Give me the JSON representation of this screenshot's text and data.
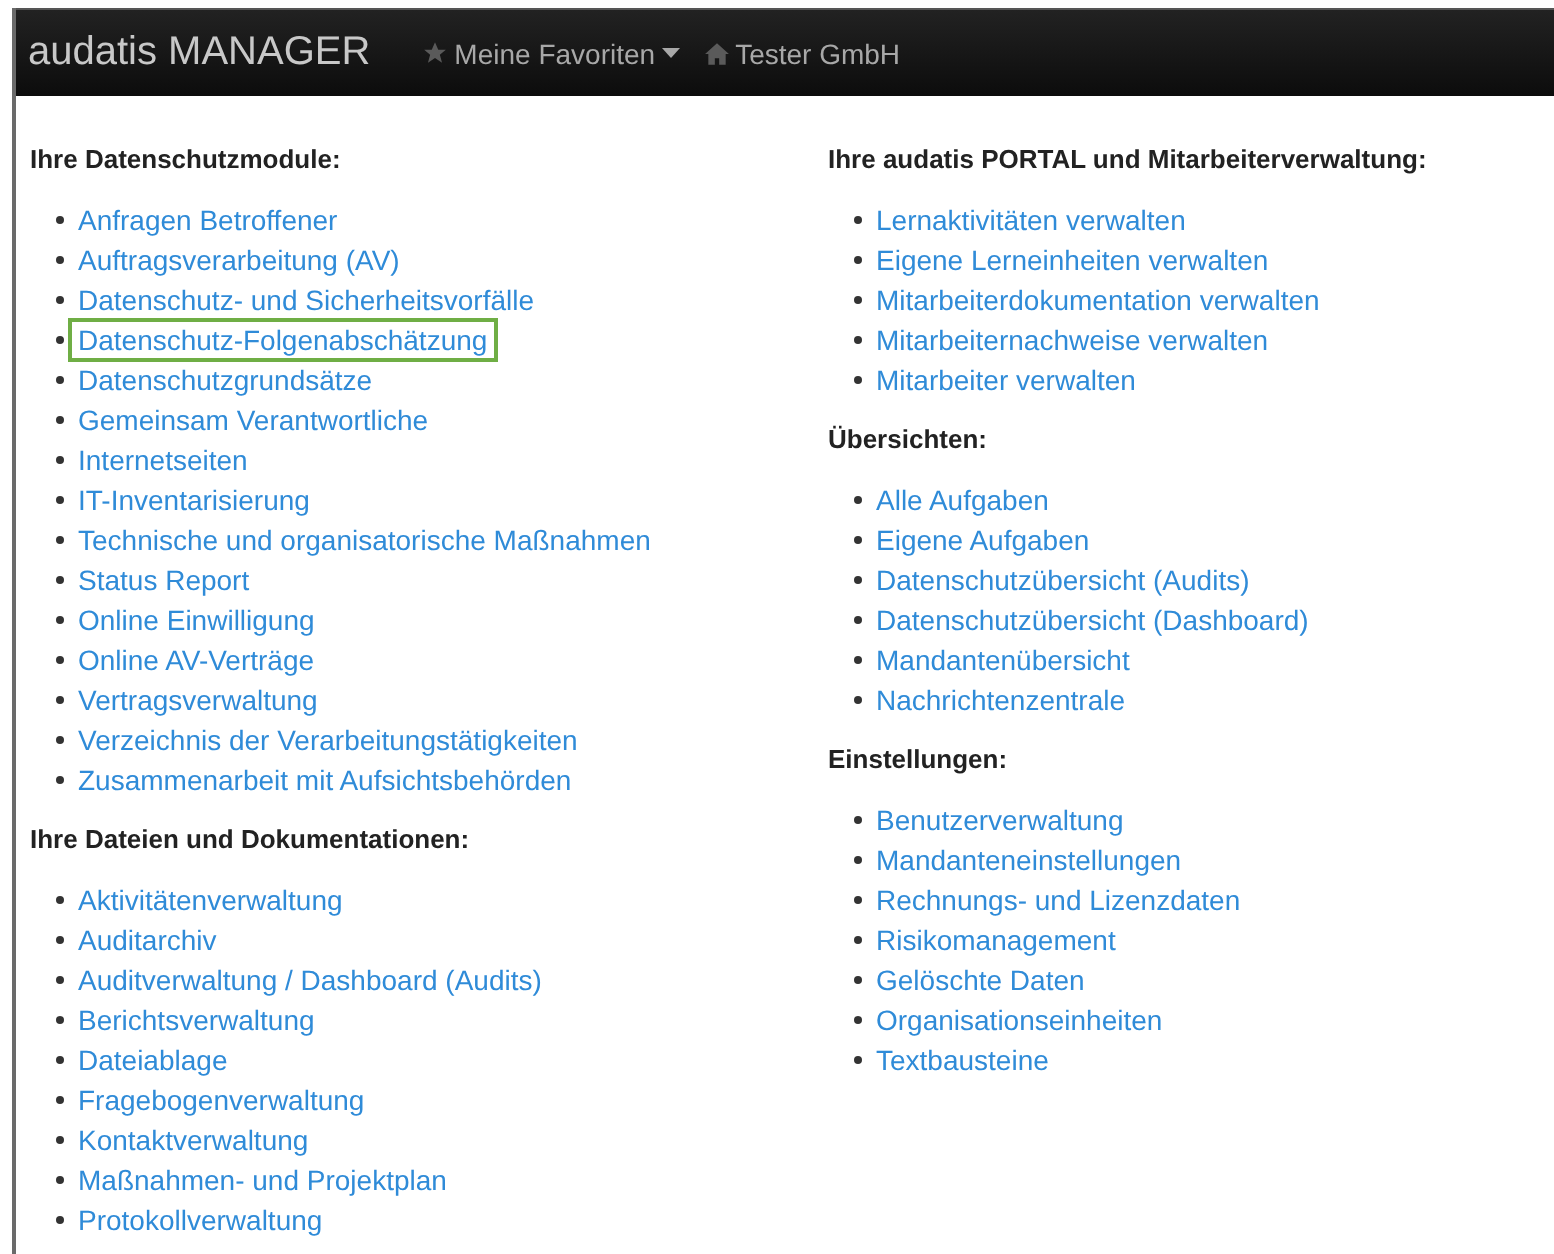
{
  "navbar": {
    "brand": "audatis MANAGER",
    "menus": [
      {
        "kind": "dropdown",
        "label": "Meine Favoriten"
      },
      {
        "kind": "home",
        "label": "Tester GmbH"
      }
    ]
  },
  "columns": [
    {
      "sections": [
        {
          "heading": "Ihre Datenschutzmodule:",
          "links": [
            {
              "label": "Anfragen Betroffener",
              "highlighted": false
            },
            {
              "label": "Auftragsverarbeitung (AV)",
              "highlighted": false
            },
            {
              "label": "Datenschutz- und Sicherheitsvorfälle",
              "highlighted": false
            },
            {
              "label": "Datenschutz-Folgenabschätzung",
              "highlighted": true
            },
            {
              "label": "Datenschutzgrundsätze",
              "highlighted": false
            },
            {
              "label": "Gemeinsam Verantwortliche",
              "highlighted": false
            },
            {
              "label": "Internetseiten",
              "highlighted": false
            },
            {
              "label": "IT-Inventarisierung",
              "highlighted": false
            },
            {
              "label": "Technische und organisatorische Maßnahmen",
              "highlighted": false
            },
            {
              "label": "Status Report",
              "highlighted": false
            },
            {
              "label": "Online Einwilligung",
              "highlighted": false
            },
            {
              "label": "Online AV-Verträge",
              "highlighted": false
            },
            {
              "label": "Vertragsverwaltung",
              "highlighted": false
            },
            {
              "label": "Verzeichnis der Verarbeitungstätigkeiten",
              "highlighted": false
            },
            {
              "label": "Zusammenarbeit mit Aufsichtsbehörden",
              "highlighted": false
            }
          ]
        },
        {
          "heading": "Ihre Dateien und Dokumentationen:",
          "links": [
            {
              "label": "Aktivitätenverwaltung",
              "highlighted": false
            },
            {
              "label": "Auditarchiv",
              "highlighted": false
            },
            {
              "label": "Auditverwaltung / Dashboard (Audits)",
              "highlighted": false
            },
            {
              "label": "Berichtsverwaltung",
              "highlighted": false
            },
            {
              "label": "Dateiablage",
              "highlighted": false
            },
            {
              "label": "Fragebogenverwaltung",
              "highlighted": false
            },
            {
              "label": "Kontaktverwaltung",
              "highlighted": false
            },
            {
              "label": "Maßnahmen- und Projektplan",
              "highlighted": false
            },
            {
              "label": "Protokollverwaltung",
              "highlighted": false
            }
          ]
        }
      ]
    },
    {
      "sections": [
        {
          "heading": "Ihre audatis PORTAL und Mitarbeiterverwaltung:",
          "links": [
            {
              "label": "Lernaktivitäten verwalten",
              "highlighted": false
            },
            {
              "label": "Eigene Lerneinheiten verwalten",
              "highlighted": false
            },
            {
              "label": "Mitarbeiterdokumentation verwalten",
              "highlighted": false
            },
            {
              "label": "Mitarbeiternachweise verwalten",
              "highlighted": false
            },
            {
              "label": "Mitarbeiter verwalten",
              "highlighted": false
            }
          ]
        },
        {
          "heading": "Übersichten:",
          "links": [
            {
              "label": "Alle Aufgaben",
              "highlighted": false
            },
            {
              "label": "Eigene Aufgaben",
              "highlighted": false
            },
            {
              "label": "Datenschutzübersicht (Audits)",
              "highlighted": false
            },
            {
              "label": "Datenschutzübersicht (Dashboard)",
              "highlighted": false
            },
            {
              "label": "Mandantenübersicht",
              "highlighted": false
            },
            {
              "label": "Nachrichtenzentrale",
              "highlighted": false
            }
          ]
        },
        {
          "heading": "Einstellungen:",
          "links": [
            {
              "label": "Benutzerverwaltung",
              "highlighted": false
            },
            {
              "label": "Mandanteneinstellungen",
              "highlighted": false
            },
            {
              "label": "Rechnungs- und Lizenzdaten",
              "highlighted": false
            },
            {
              "label": "Risikomanagement",
              "highlighted": false
            },
            {
              "label": "Gelöschte Daten",
              "highlighted": false
            },
            {
              "label": "Organisationseinheiten",
              "highlighted": false
            },
            {
              "label": "Textbausteine",
              "highlighted": false
            }
          ]
        }
      ]
    }
  ]
}
